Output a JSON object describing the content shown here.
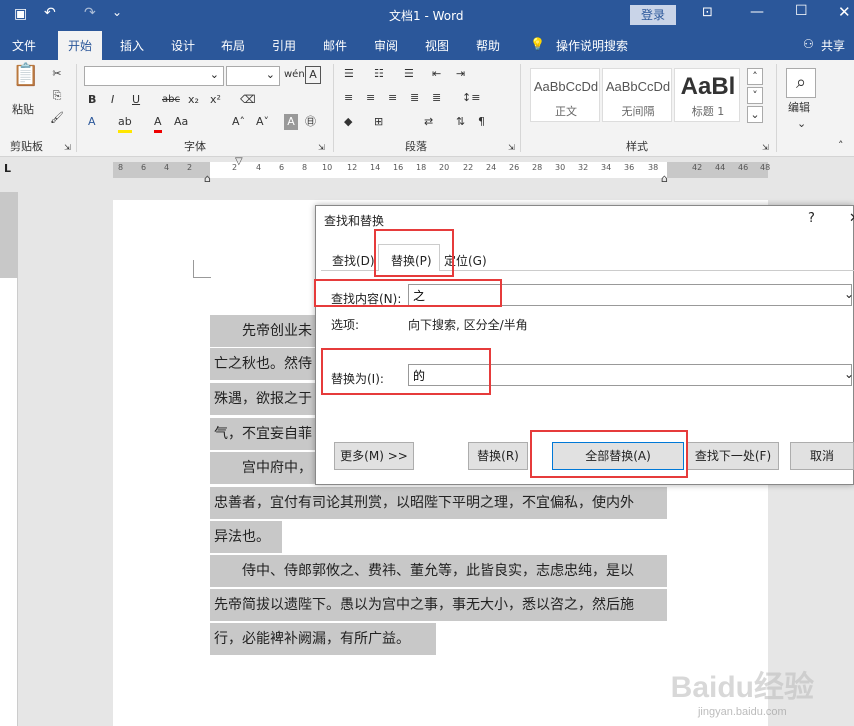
{
  "window": {
    "title": "文档1 - Word",
    "login_label": "登录"
  },
  "tabs": [
    "文件",
    "开始",
    "插入",
    "设计",
    "布局",
    "引用",
    "邮件",
    "审阅",
    "视图",
    "帮助",
    "操作说明搜索"
  ],
  "share_label": "共享",
  "ribbon": {
    "clipboard": {
      "group": "剪贴板",
      "paste": "粘贴"
    },
    "font": {
      "group": "字体"
    },
    "paragraph": {
      "group": "段落"
    },
    "styles": {
      "group": "样式",
      "items": [
        {
          "preview": "AaBbCcDd",
          "name": "正文"
        },
        {
          "preview": "AaBbCcDd",
          "name": "无间隔"
        },
        {
          "preview": "AaBl",
          "name": "标题 1"
        }
      ]
    },
    "editing": {
      "label": "编辑"
    }
  },
  "ruler": {
    "ticks": [
      "8",
      "6",
      "4",
      "2",
      "2",
      "4",
      "6",
      "8",
      "10",
      "12",
      "14",
      "16",
      "18",
      "20",
      "22",
      "24",
      "26",
      "28",
      "30",
      "32",
      "34",
      "36",
      "38",
      "42",
      "44",
      "46",
      "48"
    ]
  },
  "document": {
    "lines": [
      "先帝创业未",
      "亡之秋也。然侍",
      "殊遇，欲报之于",
      "气，不宜妄自菲",
      "宫中府中，",
      "忠善者，宜付有司论其刑赏，以昭陛下平明之理，不宜偏私，使内外",
      "异法也。",
      "侍中、侍郎郭攸之、费祎、董允等，此皆良实，志虑忠纯，是以",
      "先帝简拔以遗陛下。愚以为宫中之事，事无大小，悉以咨之，然后施",
      "行，必能裨补阙漏，有所广益。"
    ]
  },
  "dialog": {
    "title": "查找和替换",
    "help": "?",
    "tabs": [
      "查找(D)",
      "替换(P)",
      "定位(G)"
    ],
    "find_label": "查找内容(N):",
    "find_value": "之",
    "options_label": "选项:",
    "options_value": "向下搜索, 区分全/半角",
    "replace_label": "替换为(I):",
    "replace_value": "的",
    "buttons": {
      "more": "更多(M) >>",
      "replace": "替换(R)",
      "replace_all": "全部替换(A)",
      "find_next": "查找下一处(F)",
      "cancel": "取消"
    }
  },
  "watermark": {
    "brand": "Baidu经验",
    "url": "jingyan.baidu.com"
  },
  "colors": {
    "accent": "#2b579a",
    "highlight": "#e63b3b",
    "selection": "#c8c8c8"
  }
}
